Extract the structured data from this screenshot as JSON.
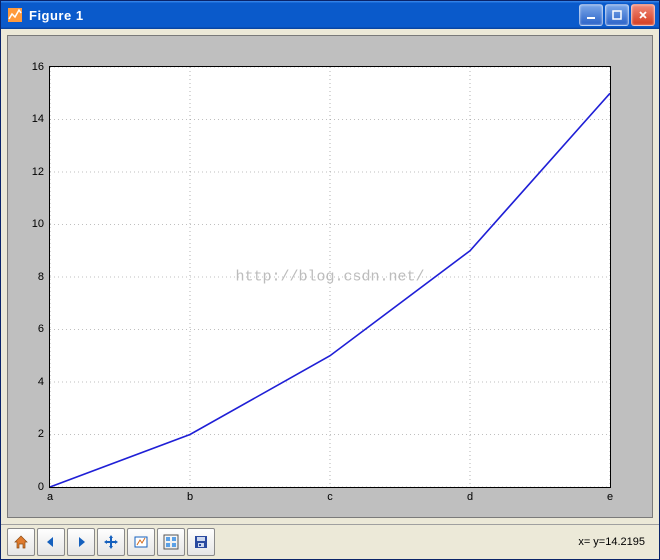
{
  "window": {
    "title": "Figure 1"
  },
  "chart_data": {
    "type": "line",
    "categories": [
      "a",
      "b",
      "c",
      "d",
      "e"
    ],
    "values": [
      0,
      2,
      5,
      9,
      15
    ],
    "x_ticks": [
      "a",
      "b",
      "c",
      "d",
      "e"
    ],
    "y_ticks": [
      0,
      2,
      4,
      6,
      8,
      10,
      12,
      14,
      16
    ],
    "ylim": [
      0,
      16
    ],
    "line_color": "#1f1fd6",
    "grid": true,
    "title": "",
    "xlabel": "",
    "ylabel": ""
  },
  "watermark": "http://blog.csdn.net/",
  "status": {
    "coord_text": "x= y=14.2195"
  },
  "toolbar": {
    "home": "home-icon",
    "back": "back-icon",
    "forward": "forward-icon",
    "pan": "pan-icon",
    "zoom": "zoom-icon",
    "subplots": "subplots-icon",
    "save": "save-icon"
  }
}
